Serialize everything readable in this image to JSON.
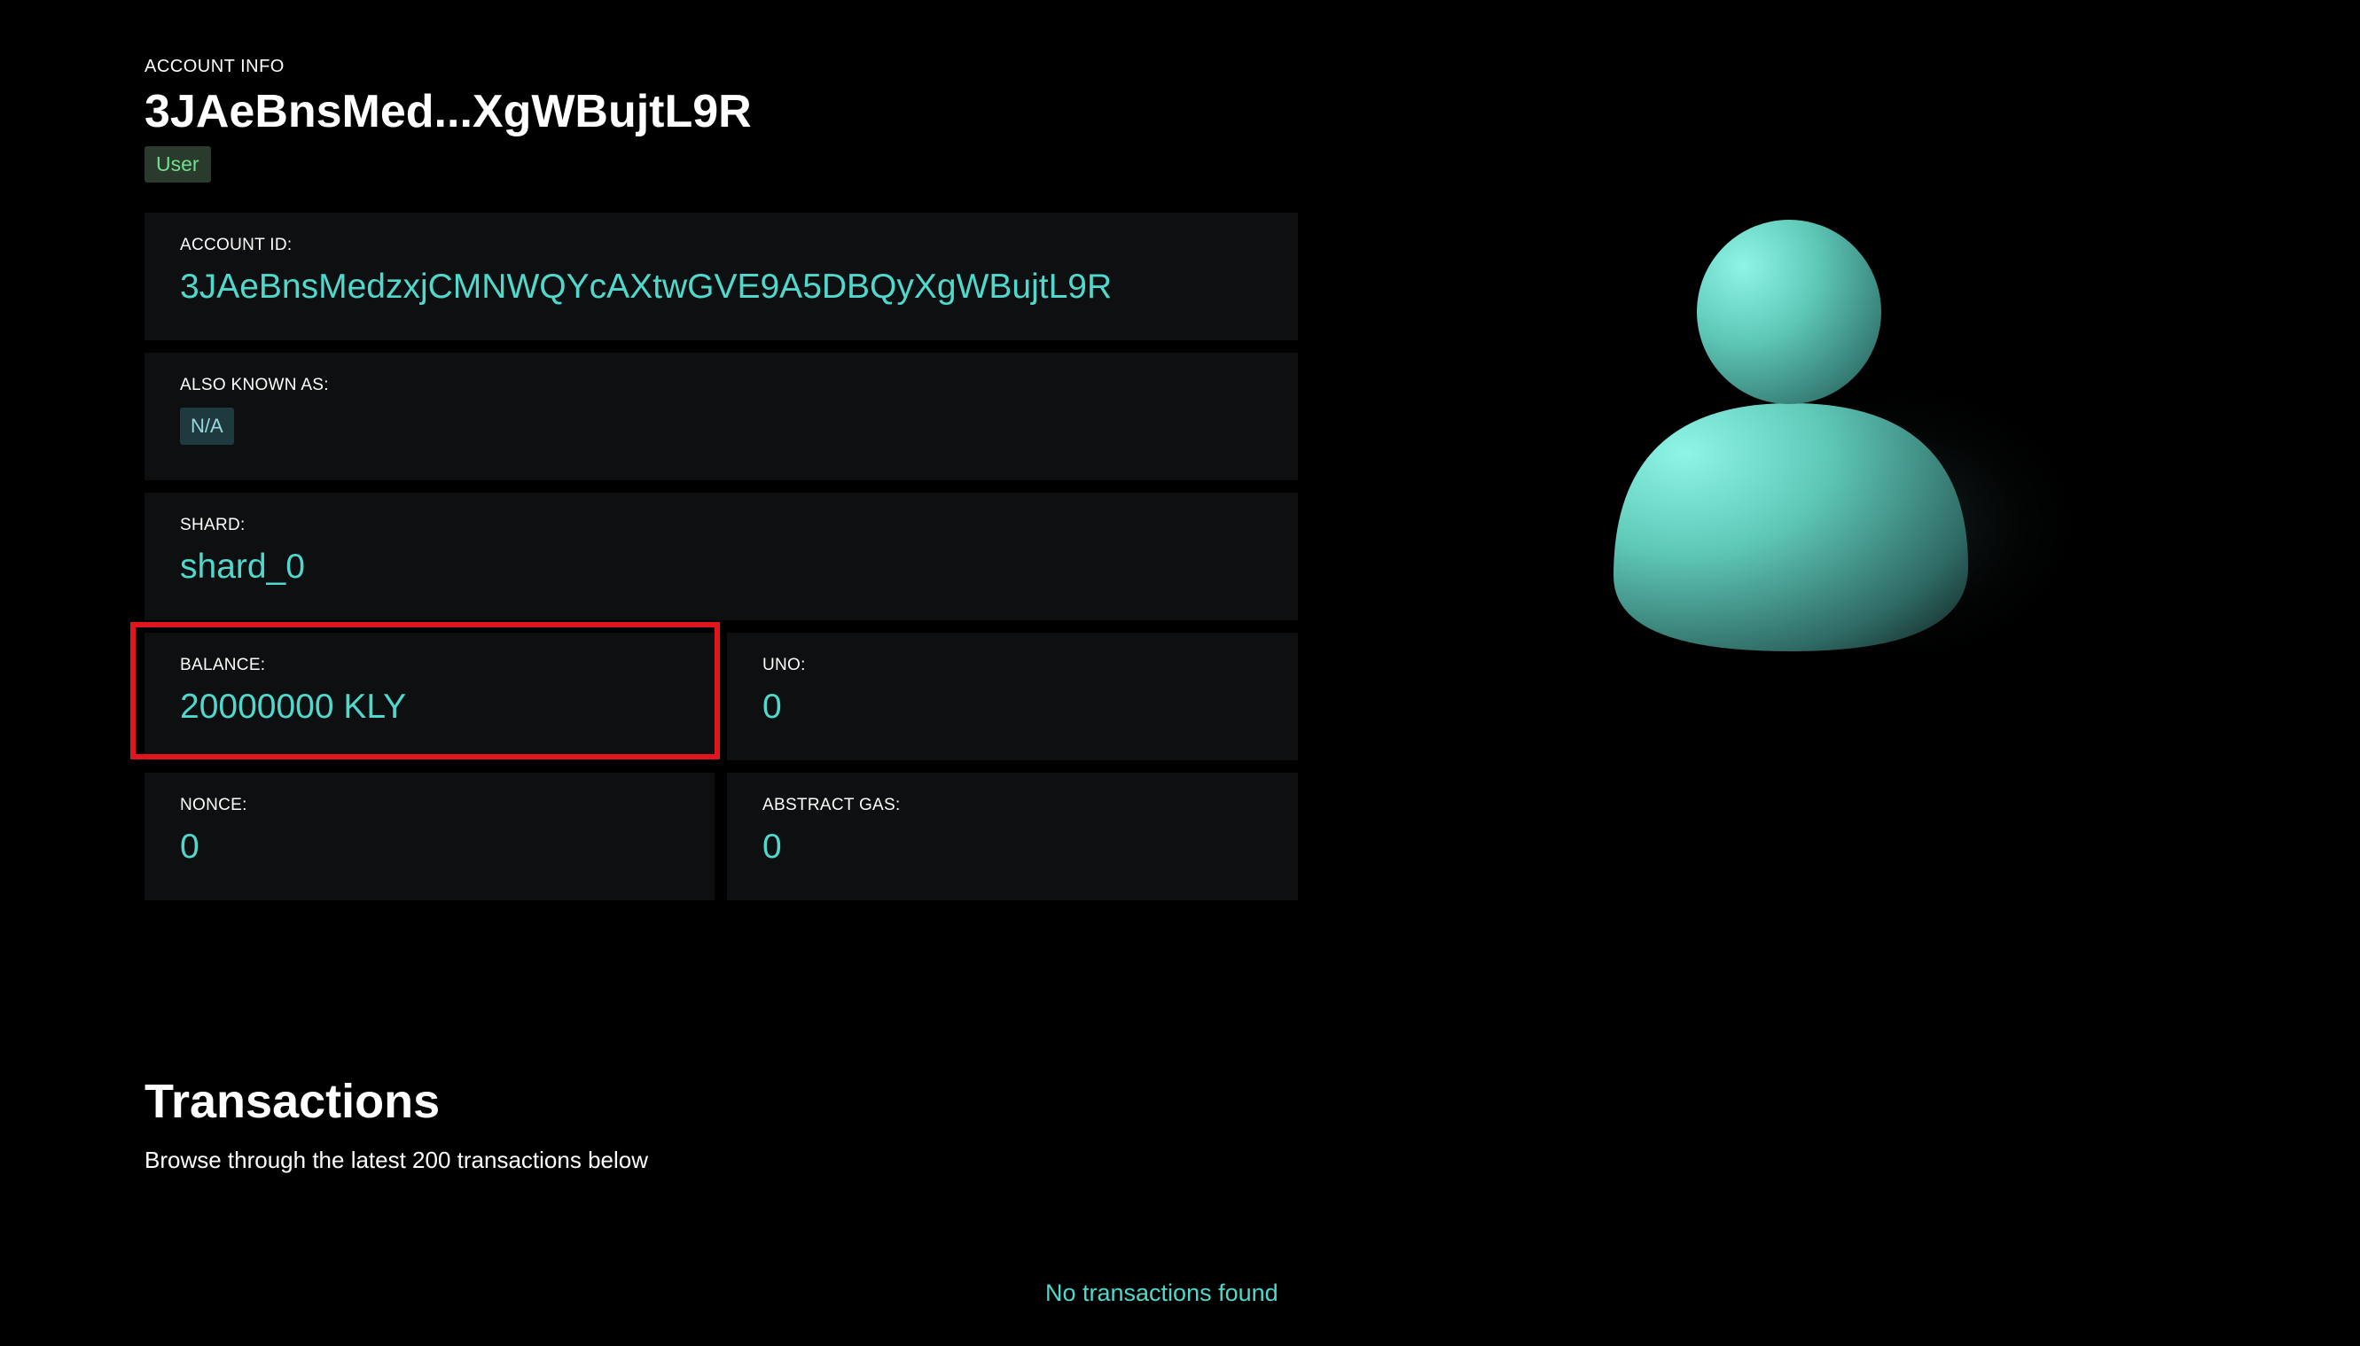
{
  "header": {
    "eyebrow": "ACCOUNT INFO",
    "title": "3JAeBnsMed...XgWBujtL9R",
    "role_badge": "User"
  },
  "cards": {
    "account_id": {
      "label": "ACCOUNT ID:",
      "value": "3JAeBnsMedzxjCMNWQYcAXtwGVE9A5DBQyXgWBujtL9R"
    },
    "aka": {
      "label": "ALSO KNOWN AS:",
      "value": "N/A"
    },
    "shard": {
      "label": "SHARD:",
      "value": "shard_0"
    },
    "balance": {
      "label": "BALANCE:",
      "value": "20000000 KLY"
    },
    "uno": {
      "label": "UNO:",
      "value": "0"
    },
    "nonce": {
      "label": "NONCE:",
      "value": "0"
    },
    "abstract_gas": {
      "label": "ABSTRACT GAS:",
      "value": "0"
    }
  },
  "avatar": {
    "icon": "user-avatar-icon"
  },
  "transactions": {
    "title": "Transactions",
    "subtitle": "Browse through the latest 200 transactions below",
    "empty_message": "No transactions found"
  },
  "colors": {
    "accent": "#4fd8cb",
    "card_bg": "#0e0f10",
    "highlight": "#e0161f",
    "badge_text": "#6ee08c"
  }
}
